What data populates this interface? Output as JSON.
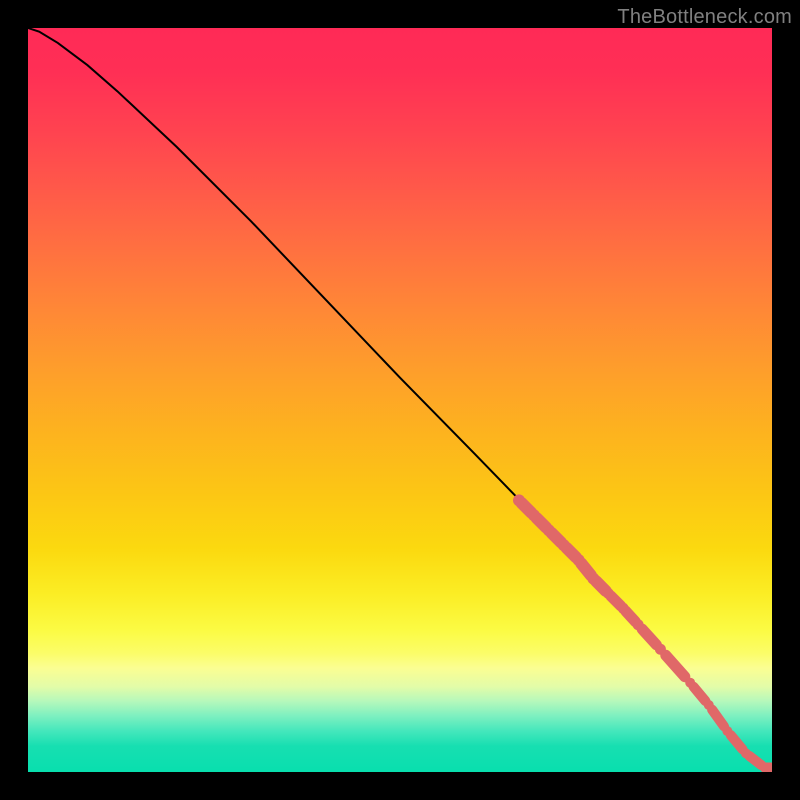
{
  "attribution": "TheBottleneck.com",
  "chart_data": {
    "type": "line",
    "title": "",
    "xlabel": "",
    "ylabel": "",
    "xlim": [
      0,
      100
    ],
    "ylim": [
      0,
      100
    ],
    "x": [
      0,
      1.5,
      4,
      8,
      12,
      20,
      30,
      40,
      50,
      60,
      70,
      80,
      88,
      92,
      95,
      97,
      99,
      100
    ],
    "y": [
      100,
      99.5,
      98,
      95,
      91.5,
      84,
      74,
      63.5,
      53,
      42.8,
      32.5,
      22,
      13.5,
      8,
      4,
      1.8,
      0.6,
      0.6
    ],
    "markers": {
      "style": "round",
      "color": "#e06868",
      "points_x": [
        66,
        68,
        70,
        72,
        74,
        76,
        78,
        80,
        82,
        85,
        89,
        91.5,
        94,
        96.5,
        99,
        100
      ],
      "points_y": [
        36.5,
        34.5,
        32.5,
        30.5,
        28.5,
        26,
        24,
        22,
        19.8,
        16.5,
        12,
        9,
        5.5,
        2.5,
        0.6,
        0.6
      ]
    },
    "annotations": []
  },
  "colors": {
    "line": "#000000",
    "marker": "#e06868",
    "bg_top": "#ff2a56",
    "bg_bottom": "#08dfae"
  }
}
